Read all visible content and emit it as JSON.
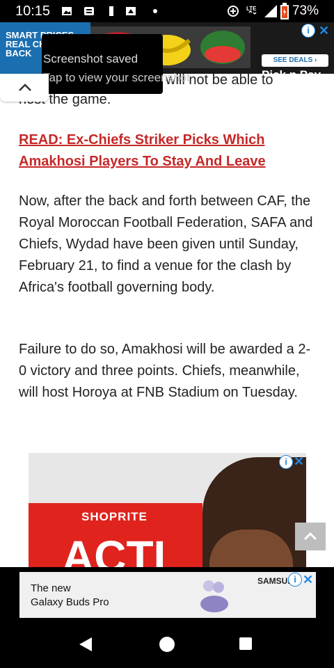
{
  "status_bar": {
    "time": "10:15",
    "battery_percent": "73%",
    "network": "LTE",
    "icons": [
      "image-icon",
      "message-icon",
      "battery-saver-icon",
      "screenshot-icon",
      "dot-icon",
      "data-saver-icon",
      "lte-icon",
      "signal-icon",
      "battery-icon"
    ]
  },
  "top_ad": {
    "left_text": "SMART PRICES REAL CHANGE BACK",
    "see_deals": "SEE DEALS ›",
    "brand": "Pick n Pay",
    "info_label": "i",
    "close_label": "✕"
  },
  "toast": {
    "line1": "Screenshot saved",
    "line2": "Tap to view your screenshot"
  },
  "article": {
    "partial_top": "will not be able to",
    "partial_line2": "host the game.",
    "read_link": "READ: Ex-Chiefs Striker Picks Which Amakhosi Players To Stay And Leave",
    "para1": "Now, after the back and forth between CAF, the Royal Moroccan Football Federation, SAFA and Chiefs, Wydad have been given until Sunday, February 21, to find a venue for the clash by Africa's football governing body.",
    "para2": "Failure to do so, Amakhosi will be awarded a 2-0 victory and three points. Chiefs, meanwhile, will host Horoya at FNB Stadium on Tuesday."
  },
  "content_ad": {
    "brand": "SHOPRITE",
    "headline": "ACTI",
    "info_label": "i",
    "close_label": "✕"
  },
  "bottom_ad": {
    "text_line1": "The new",
    "text_line2": "Galaxy Buds Pro",
    "brand": "SAMSUNG",
    "info_label": "i",
    "close_label": "✕"
  },
  "colors": {
    "link": "#c62828",
    "ad_icons": "#1e88e5",
    "shoprite_red": "#e0231d"
  }
}
